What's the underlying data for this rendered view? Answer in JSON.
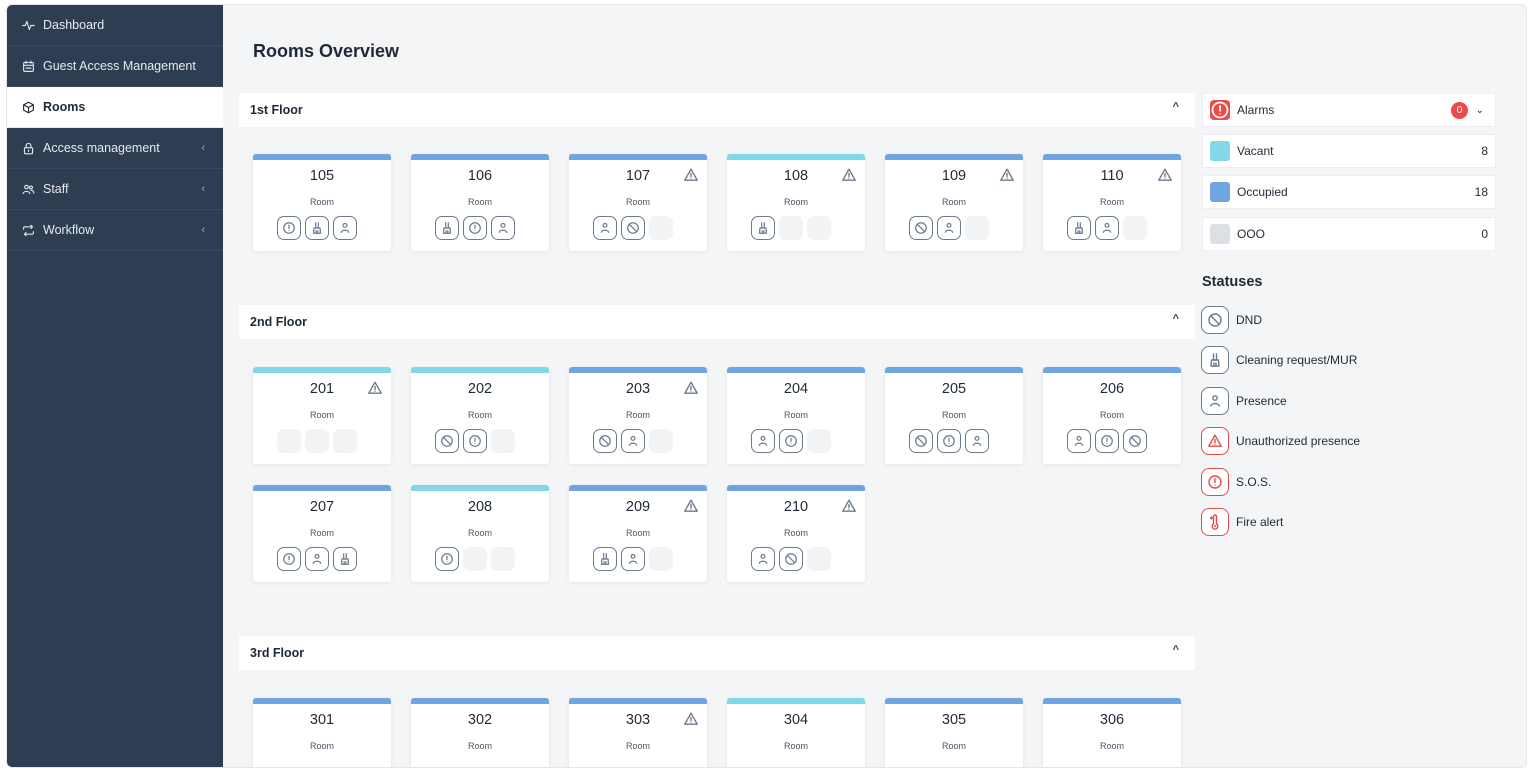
{
  "sidebar": {
    "items": [
      {
        "label": "Dashboard",
        "icon": "activity-icon",
        "has_chevron": false,
        "active": false
      },
      {
        "label": "Guest Access Management",
        "icon": "calendar-icon",
        "has_chevron": false,
        "active": false
      },
      {
        "label": "Rooms",
        "icon": "cube-icon",
        "has_chevron": false,
        "active": true
      },
      {
        "label": "Access management",
        "icon": "lock-icon",
        "has_chevron": true,
        "active": false
      },
      {
        "label": "Staff",
        "icon": "users-icon",
        "has_chevron": true,
        "active": false
      },
      {
        "label": "Workflow",
        "icon": "repeat-icon",
        "has_chevron": true,
        "active": false
      }
    ],
    "chevron": "‹"
  },
  "main": {
    "title": "Rooms Overview",
    "collapse_glyph": "^",
    "room_label": "Room",
    "floors": [
      {
        "name": "1st Floor",
        "rooms": [
          {
            "number": "105",
            "color": "occupied",
            "warning": false,
            "icons": [
              "sos",
              "cleaning",
              "presence"
            ]
          },
          {
            "number": "106",
            "color": "occupied",
            "warning": false,
            "icons": [
              "cleaning",
              "sos",
              "presence"
            ]
          },
          {
            "number": "107",
            "color": "occupied",
            "warning": true,
            "icons": [
              "presence",
              "dnd",
              "empty"
            ]
          },
          {
            "number": "108",
            "color": "vacant",
            "warning": true,
            "icons": [
              "cleaning",
              "empty",
              "empty"
            ]
          },
          {
            "number": "109",
            "color": "occupied",
            "warning": true,
            "icons": [
              "dnd",
              "presence",
              "empty"
            ]
          },
          {
            "number": "110",
            "color": "occupied",
            "warning": true,
            "icons": [
              "cleaning",
              "presence",
              "empty"
            ]
          }
        ]
      },
      {
        "name": "2nd Floor",
        "rooms": [
          {
            "number": "201",
            "color": "vacant",
            "warning": true,
            "icons": [
              "empty",
              "empty",
              "empty"
            ]
          },
          {
            "number": "202",
            "color": "vacant",
            "warning": false,
            "icons": [
              "dnd",
              "sos",
              "empty"
            ]
          },
          {
            "number": "203",
            "color": "occupied",
            "warning": true,
            "icons": [
              "dnd",
              "presence",
              "empty"
            ]
          },
          {
            "number": "204",
            "color": "occupied",
            "warning": false,
            "icons": [
              "presence",
              "sos",
              "empty"
            ]
          },
          {
            "number": "205",
            "color": "occupied",
            "warning": false,
            "icons": [
              "dnd",
              "sos",
              "presence"
            ]
          },
          {
            "number": "206",
            "color": "occupied",
            "warning": false,
            "icons": [
              "presence",
              "sos",
              "dnd"
            ]
          },
          {
            "number": "207",
            "color": "occupied",
            "warning": false,
            "icons": [
              "sos",
              "presence",
              "cleaning"
            ]
          },
          {
            "number": "208",
            "color": "vacant",
            "warning": false,
            "icons": [
              "sos",
              "empty",
              "empty"
            ]
          },
          {
            "number": "209",
            "color": "occupied",
            "warning": true,
            "icons": [
              "cleaning",
              "presence",
              "empty"
            ]
          },
          {
            "number": "210",
            "color": "occupied",
            "warning": true,
            "icons": [
              "presence",
              "dnd",
              "empty"
            ]
          }
        ]
      },
      {
        "name": "3rd Floor",
        "rooms": [
          {
            "number": "301",
            "color": "occupied",
            "warning": false,
            "icons": []
          },
          {
            "number": "302",
            "color": "occupied",
            "warning": false,
            "icons": []
          },
          {
            "number": "303",
            "color": "occupied",
            "warning": true,
            "icons": []
          },
          {
            "number": "304",
            "color": "vacant",
            "warning": false,
            "icons": []
          },
          {
            "number": "305",
            "color": "occupied",
            "warning": false,
            "icons": []
          },
          {
            "number": "306",
            "color": "occupied",
            "warning": false,
            "icons": []
          }
        ]
      }
    ]
  },
  "right_panel": {
    "alarms": {
      "label": "Alarms",
      "count": "0",
      "dropdown_glyph": "⌄"
    },
    "occupancy": [
      {
        "label": "Vacant",
        "count": "8",
        "color": "#82d8e8"
      },
      {
        "label": "Occupied",
        "count": "18",
        "color": "#6fa6e2"
      },
      {
        "label": "OOO",
        "count": "0",
        "color": "#dcdfe3"
      }
    ],
    "statuses_title": "Statuses",
    "statuses": [
      {
        "label": "DND",
        "icon": "dnd",
        "alert": false
      },
      {
        "label": "Cleaning request/MUR",
        "icon": "cleaning",
        "alert": false
      },
      {
        "label": "Presence",
        "icon": "presence",
        "alert": false
      },
      {
        "label": "Unauthorized presence",
        "icon": "warning",
        "alert": true
      },
      {
        "label": "S.O.S.",
        "icon": "sos",
        "alert": true
      },
      {
        "label": "Fire alert",
        "icon": "fire",
        "alert": true
      }
    ]
  },
  "colors": {
    "occupied": "#6fa6e2",
    "vacant": "#82d8e8",
    "sidebar_bg": "#2f3d52",
    "alert_red": "#e34b4b",
    "icon_gray": "#6b7a8d"
  }
}
